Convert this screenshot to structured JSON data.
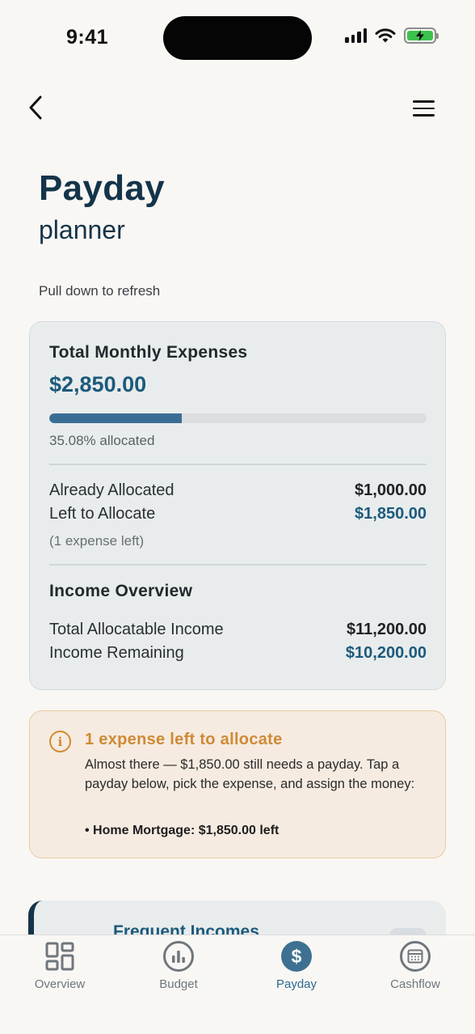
{
  "status_bar": {
    "time": "9:41"
  },
  "header": {
    "title": "Payday",
    "subtitle": "planner",
    "refresh_hint": "Pull down to refresh"
  },
  "summary": {
    "heading": "Total Monthly Expenses",
    "total": "$2,850.00",
    "allocated_fraction": 0.3508,
    "allocated_text": "35.08% allocated",
    "already_allocated_label": "Already Allocated",
    "already_allocated_value": "$1,000.00",
    "left_to_allocate_label": "Left to Allocate",
    "left_to_allocate_value": "$1,850.00",
    "expense_left_note": "(1 expense left)",
    "income_heading": "Income Overview",
    "total_income_label": "Total Allocatable Income",
    "total_income_value": "$11,200.00",
    "income_remaining_label": "Income Remaining",
    "income_remaining_value": "$10,200.00"
  },
  "alert": {
    "title": "1 expense left to allocate",
    "body": "Almost there — $1,850.00 still needs a payday. Tap a payday below, pick the expense, and assign the money:",
    "bullet": "• Home Mortgage: $1,850.00 left"
  },
  "income_card": {
    "title": "Frequent Incomes",
    "arrow": "→"
  },
  "tabs": [
    {
      "label": "Overview",
      "icon": "grid-icon"
    },
    {
      "label": "Budget",
      "icon": "bar-chart-icon"
    },
    {
      "label": "Payday",
      "icon": "dollar-icon",
      "active": true
    },
    {
      "label": "Cashflow",
      "icon": "calendar-icon"
    }
  ],
  "colors": {
    "primary": "#14344a",
    "accent": "#1c5a7c",
    "warning": "#d08a35",
    "progress": "#3a6d95"
  }
}
